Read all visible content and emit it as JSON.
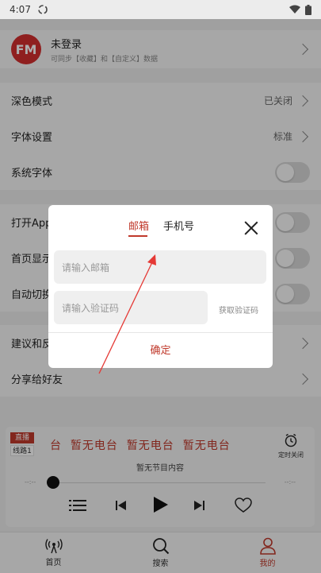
{
  "status_bar": {
    "time": "4:07"
  },
  "profile": {
    "title": "未登录",
    "subtitle": "可同步【收藏】和【自定义】数据",
    "logo_text": "FM"
  },
  "settings": {
    "dark_mode": {
      "label": "深色模式",
      "value": "已关闭"
    },
    "font_settings": {
      "label": "字体设置",
      "value": "标准"
    },
    "system_font": {
      "label": "系统字体"
    },
    "open_app": {
      "label": "打开App"
    },
    "home_display": {
      "label": "首页显示"
    },
    "auto_switch": {
      "label": "自动切换"
    },
    "suggestion": {
      "label": "建议和反馈"
    },
    "share": {
      "label": "分享给好友"
    }
  },
  "dialog": {
    "tab_email": "邮箱",
    "tab_phone": "手机号",
    "email_placeholder": "请输入邮箱",
    "code_placeholder": "请输入验证码",
    "get_code": "获取验证码",
    "confirm": "确定"
  },
  "player": {
    "live_badge": "直播",
    "line_badge": "线路1",
    "marquee": "台  暂无电台  暂无电台  暂无电台",
    "program": "暂无节目内容",
    "timer_label": "定时关闭",
    "time_left": "--:--",
    "time_right": "--:--",
    "progress": 0
  },
  "nav": {
    "home": "首页",
    "search": "搜索",
    "mine": "我的"
  },
  "colors": {
    "accent": "#c0392b"
  }
}
